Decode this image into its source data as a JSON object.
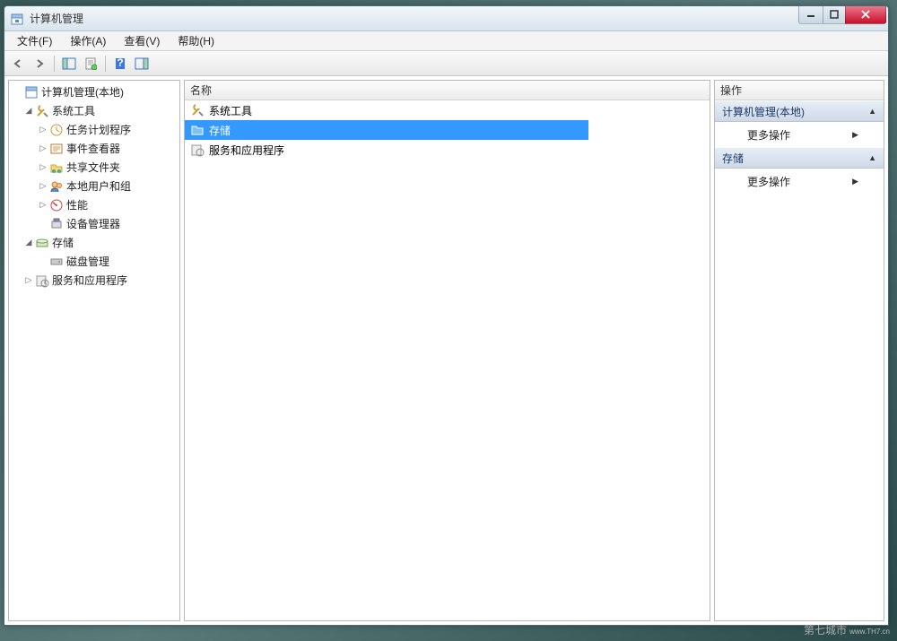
{
  "titlebar": {
    "title": "计算机管理"
  },
  "menubar": {
    "file": "文件(F)",
    "action": "操作(A)",
    "view": "查看(V)",
    "help": "帮助(H)"
  },
  "tree": {
    "root": "计算机管理(本地)",
    "system_tools": "系统工具",
    "task_scheduler": "任务计划程序",
    "event_viewer": "事件查看器",
    "shared_folders": "共享文件夹",
    "local_users": "本地用户和组",
    "performance": "性能",
    "device_manager": "设备管理器",
    "storage": "存储",
    "disk_management": "磁盘管理",
    "services_apps": "服务和应用程序"
  },
  "list": {
    "header": "名称",
    "items": [
      {
        "label": "系统工具",
        "icon": "tools-icon"
      },
      {
        "label": "存储",
        "icon": "folder-icon"
      },
      {
        "label": "服务和应用程序",
        "icon": "services-icon"
      }
    ]
  },
  "actions": {
    "header": "操作",
    "section1": "计算机管理(本地)",
    "more1": "更多操作",
    "section2": "存储",
    "more2": "更多操作"
  },
  "watermark": {
    "main": "第七城市",
    "sub": "www.TH7.cn"
  }
}
